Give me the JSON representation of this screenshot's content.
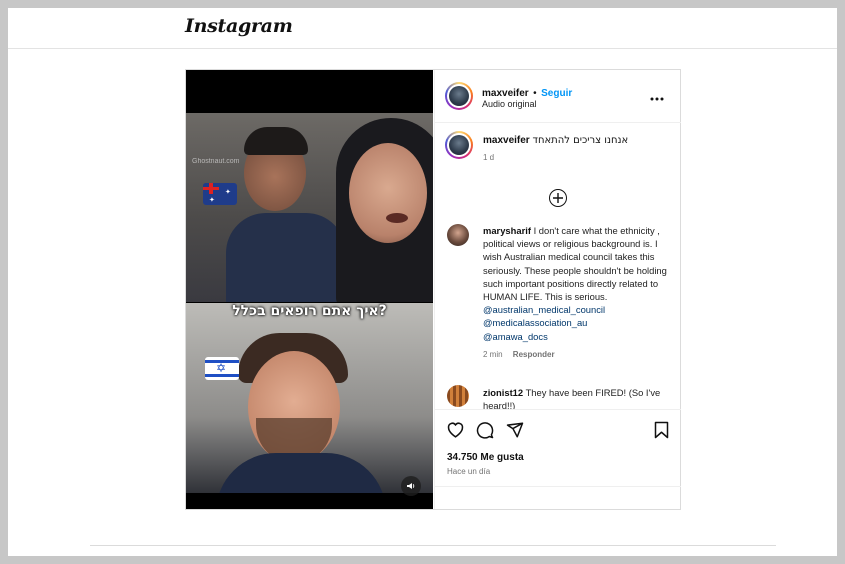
{
  "app": {
    "logo_text": "Instagram"
  },
  "post": {
    "author": "maxveifer",
    "separator": "•",
    "follow_label": "Seguir",
    "audio_label": "Audio original",
    "more_label": "•••",
    "caption_user": "maxveifer",
    "caption_text": "אנחנו צריכים להתאחד",
    "caption_age": "1 d",
    "load_more_label": "+",
    "media": {
      "overlay_text": "איך אתם רופאים בכלל?",
      "watermark": "Ghostnaut.com",
      "top_flag": "australia-flag",
      "bottom_flag": "israel-flag",
      "mute_icon": "speaker-icon"
    },
    "comments": [
      {
        "user": "marysharif",
        "text": "I don't care what the ethnicity , political views or religious background is. I wish Australian medical council takes this seriously. These people shouldn't be holding such important positions directly related to HUMAN LIFE. This is serious.",
        "mentions": [
          "@australian_medical_council",
          "@medicalassociation_au",
          "@amawa_docs"
        ],
        "age": "2 min",
        "reply_label": "Responder"
      },
      {
        "user": "zionist12",
        "text": "They have been FIRED! (So I've heard!!)"
      }
    ],
    "likes": "34.750 Me gusta",
    "posted": "Hace un día",
    "icons": [
      "heart-icon",
      "comment-icon",
      "share-icon",
      "bookmark-icon"
    ]
  }
}
